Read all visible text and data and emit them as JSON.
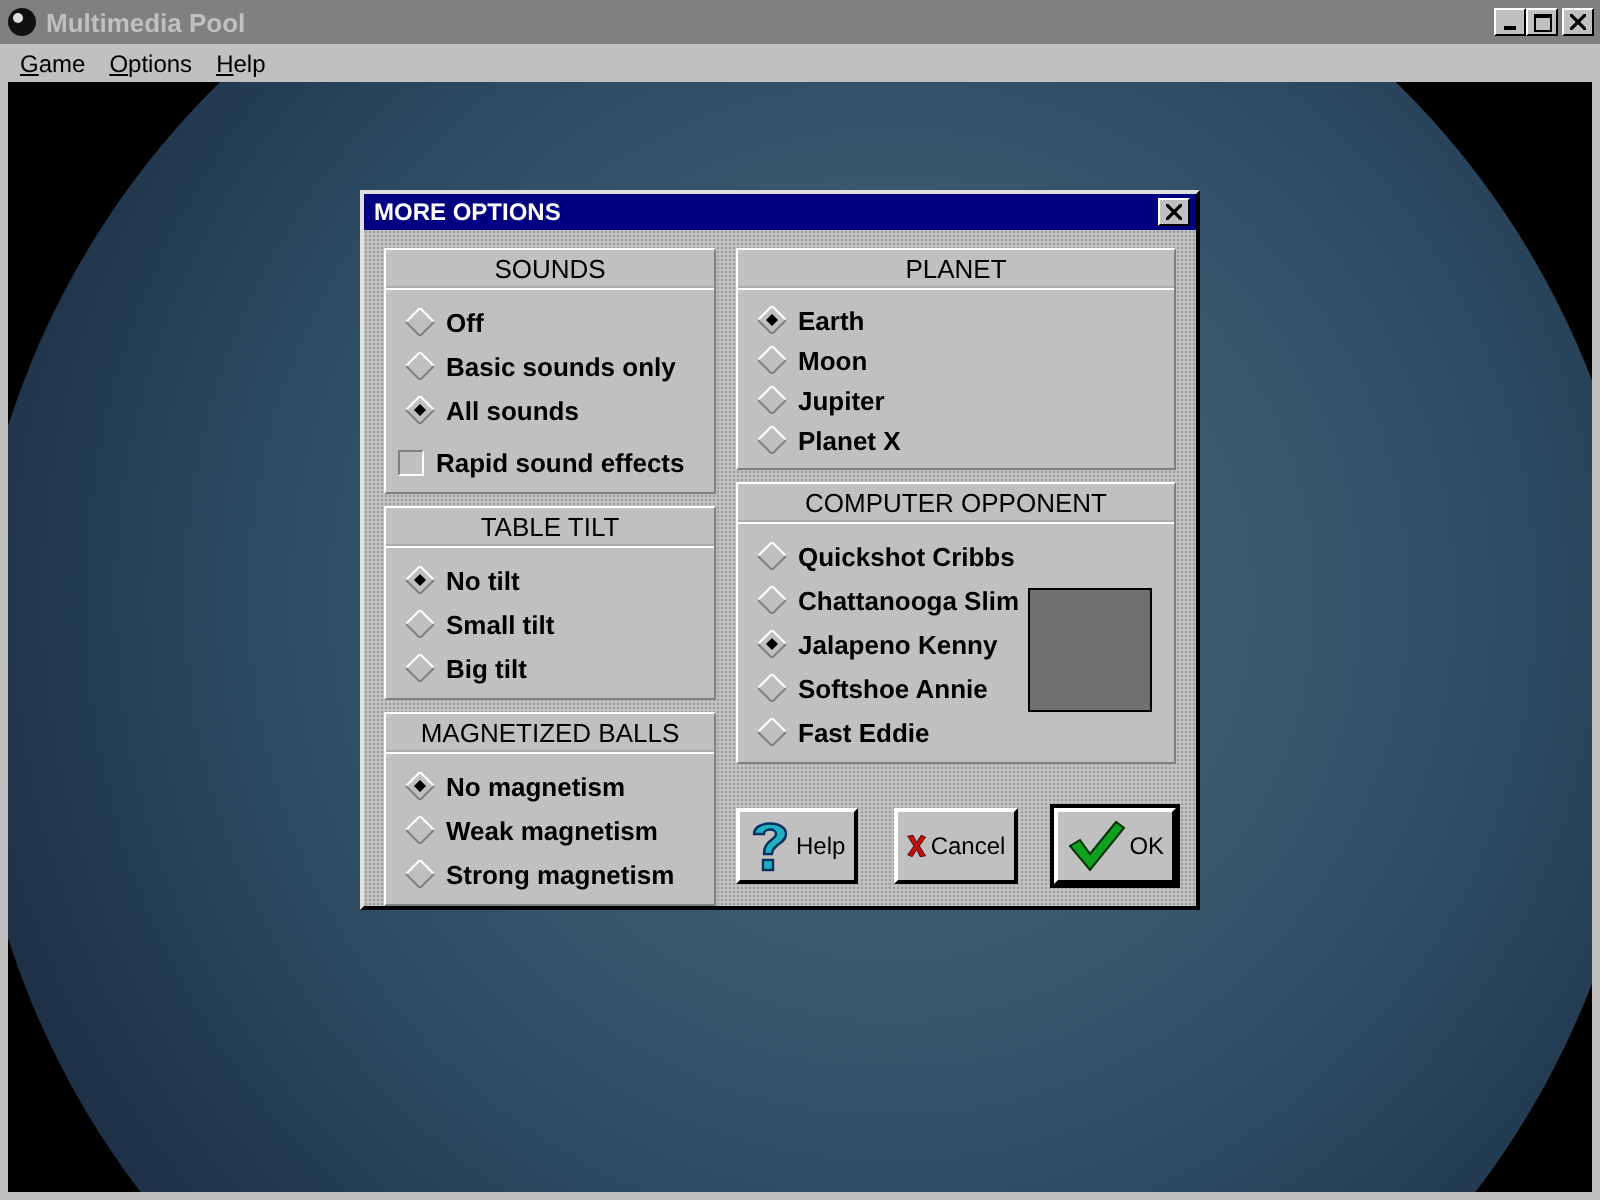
{
  "window": {
    "title": "Multimedia Pool"
  },
  "menu": [
    {
      "label": "Game"
    },
    {
      "label": "Options"
    },
    {
      "label": "Help"
    }
  ],
  "dialog": {
    "title": "MORE OPTIONS",
    "sounds": {
      "title": "SOUNDS",
      "options": [
        {
          "label": "Off",
          "selected": false
        },
        {
          "label": "Basic sounds only",
          "selected": false
        },
        {
          "label": "All sounds",
          "selected": true
        }
      ],
      "checkbox": {
        "label": "Rapid sound effects",
        "checked": false
      }
    },
    "table_tilt": {
      "title": "TABLE TILT",
      "options": [
        {
          "label": "No tilt",
          "selected": true
        },
        {
          "label": "Small tilt",
          "selected": false
        },
        {
          "label": "Big tilt",
          "selected": false
        }
      ]
    },
    "magnetized_balls": {
      "title": "MAGNETIZED BALLS",
      "options": [
        {
          "label": "No magnetism",
          "selected": true
        },
        {
          "label": "Weak magnetism",
          "selected": false
        },
        {
          "label": "Strong magnetism",
          "selected": false
        }
      ]
    },
    "planet": {
      "title": "PLANET",
      "options": [
        {
          "label": "Earth",
          "selected": true
        },
        {
          "label": "Moon",
          "selected": false
        },
        {
          "label": "Jupiter",
          "selected": false
        },
        {
          "label": "Planet X",
          "selected": false
        }
      ]
    },
    "computer_opponent": {
      "title": "COMPUTER OPPONENT",
      "options": [
        {
          "label": "Quickshot Cribbs",
          "selected": false
        },
        {
          "label": "Chattanooga Slim",
          "selected": false
        },
        {
          "label": "Jalapeno Kenny",
          "selected": true
        },
        {
          "label": "Softshoe Annie",
          "selected": false
        },
        {
          "label": "Fast Eddie",
          "selected": false
        }
      ]
    },
    "buttons": [
      {
        "label": "Help",
        "kind": "help",
        "default": false
      },
      {
        "label": "Cancel",
        "kind": "cancel",
        "default": false
      },
      {
        "label": "OK",
        "kind": "ok",
        "default": true
      }
    ]
  }
}
